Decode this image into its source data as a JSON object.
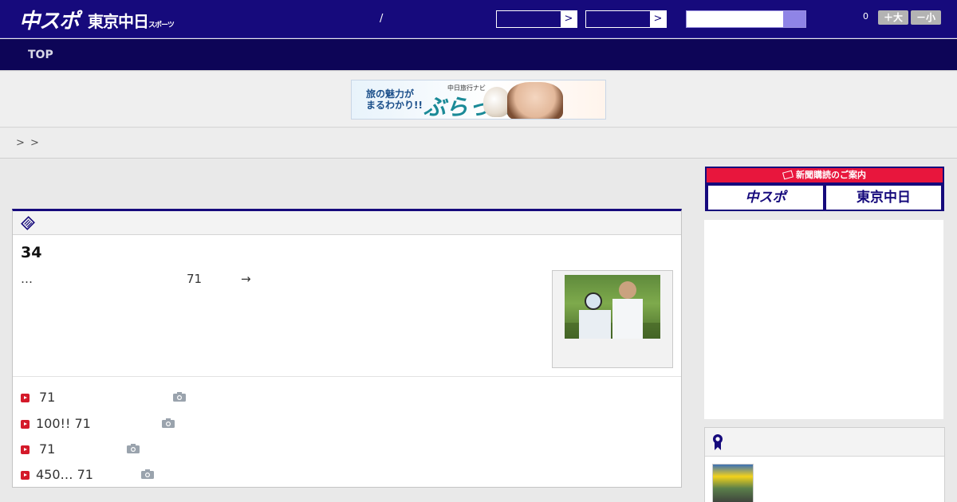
{
  "header": {
    "logo_main": "中スポ",
    "logo_sub": "東京中日",
    "logo_sub_small": "スポーツ",
    "slash": "/",
    "select_arrow": ">",
    "count": "0",
    "font_large": "＋大",
    "font_small": "－小"
  },
  "nav": {
    "top": "TOP"
  },
  "banner": {
    "line1": "旅の魅力が",
    "line2": "まるわかり!!",
    "brand_small": "中日旅行ナビ",
    "brand": "ぶらっ人"
  },
  "breadcrumb": {
    "sep1": ">",
    "sep2": ">"
  },
  "article": {
    "number": "34",
    "lead_ellipsis": "…",
    "lead_number": "71",
    "lead_arrow": "→"
  },
  "related": [
    {
      "text": "71"
    },
    {
      "text": "100!! 71"
    },
    {
      "text": "71"
    },
    {
      "text": "450… 71"
    }
  ],
  "sidebar": {
    "subscribe_title": "新聞購読のご案内",
    "subscribe_a": "中スポ",
    "subscribe_b": "東京中日"
  },
  "colors": {
    "primary": "#160a7c",
    "nav": "#0d0557",
    "accent_red": "#e8163d",
    "bullet_red": "#d41a2a"
  }
}
